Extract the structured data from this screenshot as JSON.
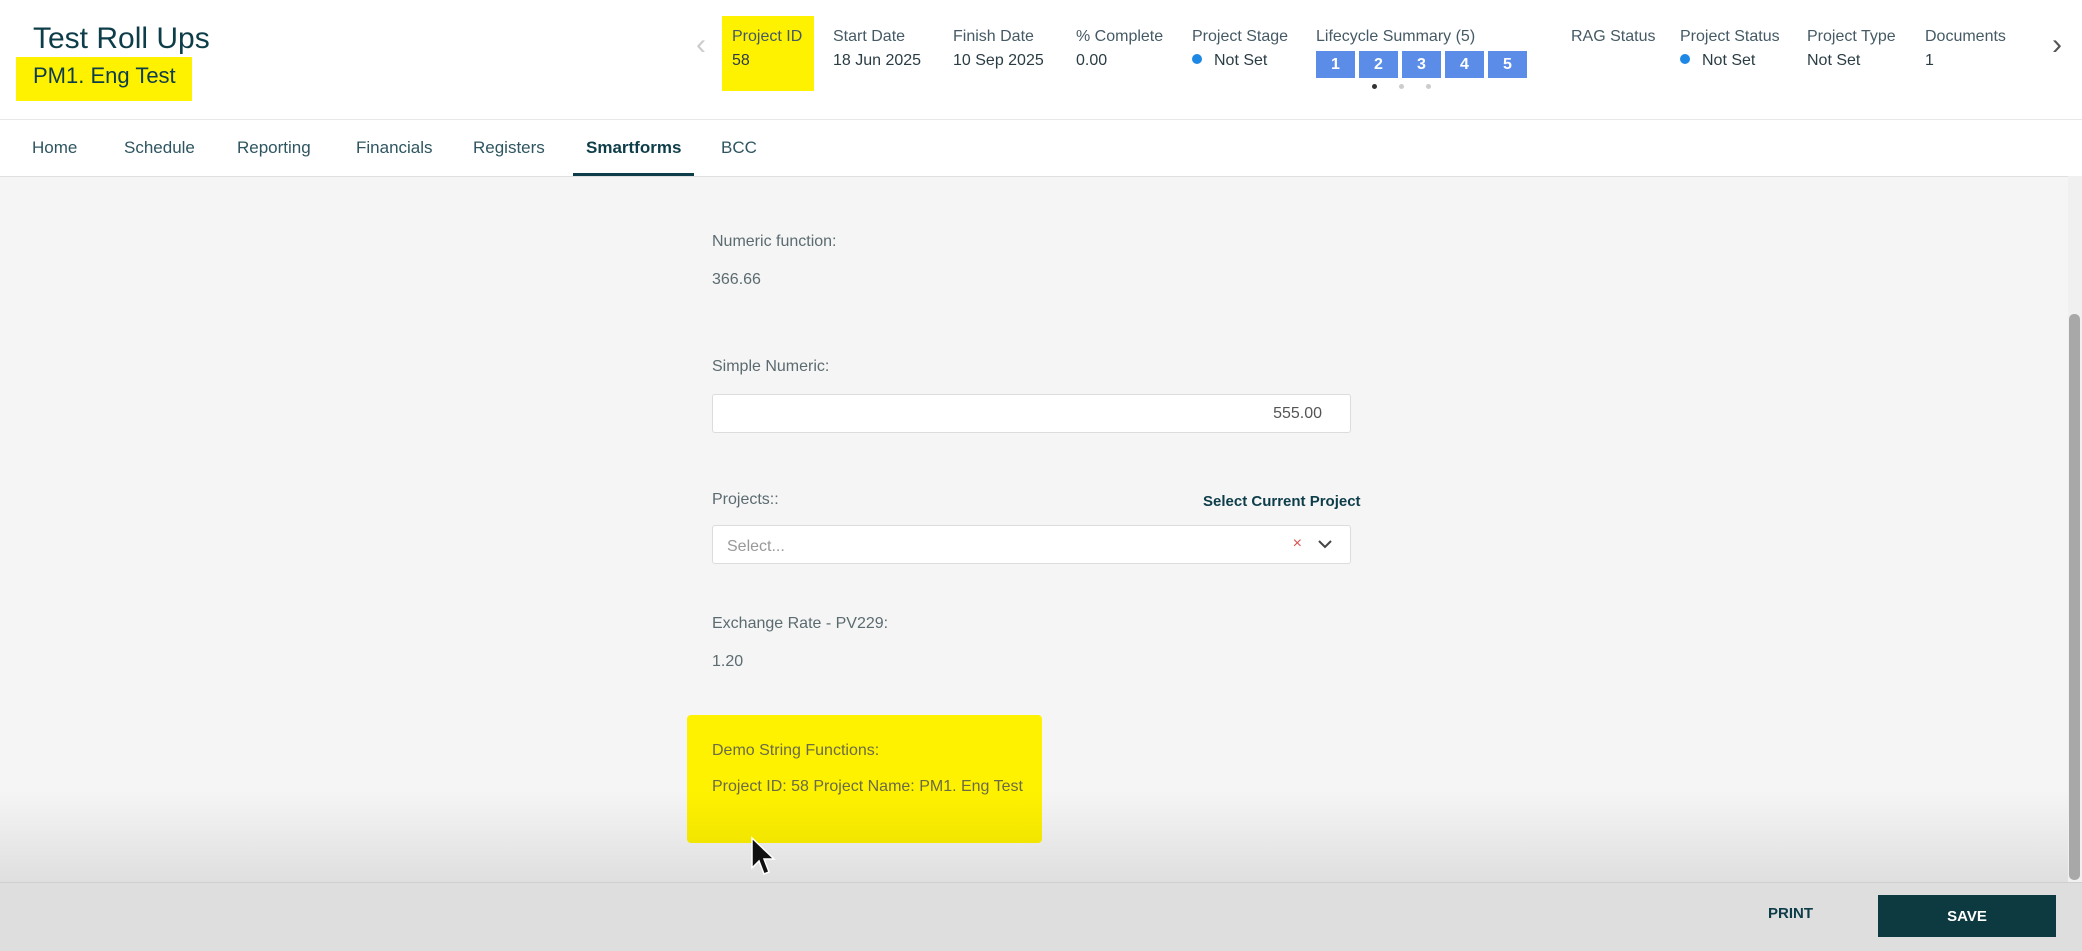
{
  "header": {
    "project_name": "Test Roll Ups",
    "project_sub": "PM1. Eng Test",
    "meta": {
      "project_id": {
        "label": "Project ID",
        "value": "58"
      },
      "start_date": {
        "label": "Start Date",
        "value": "18 Jun 2025"
      },
      "finish_date": {
        "label": "Finish Date",
        "value": "10 Sep 2025"
      },
      "percent_complete": {
        "label": "% Complete",
        "value": "0.00"
      },
      "project_stage": {
        "label": "Project Stage",
        "value": "Not Set"
      },
      "lifecycle_summary": {
        "label": "Lifecycle Summary (5)",
        "boxes": [
          "1",
          "2",
          "3",
          "4",
          "5"
        ]
      },
      "rag_status": {
        "label": "RAG Status",
        "value": ""
      },
      "project_status": {
        "label": "Project Status",
        "value": "Not Set"
      },
      "project_type": {
        "label": "Project Type",
        "value": "Not Set"
      },
      "documents": {
        "label": "Documents",
        "value": "1"
      }
    }
  },
  "tabs": [
    "Home",
    "Schedule",
    "Reporting",
    "Financials",
    "Registers",
    "Smartforms",
    "BCC"
  ],
  "active_tab": "Smartforms",
  "form": {
    "numeric_function": {
      "label": "Numeric function:",
      "value": "366.66"
    },
    "simple_numeric": {
      "label": "Simple Numeric:",
      "value": "555.00"
    },
    "projects": {
      "label": "Projects::",
      "placeholder": "Select...",
      "select_current": "Select Current Project",
      "clear_glyph": "×"
    },
    "exchange_rate": {
      "label": "Exchange Rate - PV229:",
      "value": "1.20"
    },
    "demo_string": {
      "label": "Demo String Functions:",
      "value": "Project ID: 58 Project Name: PM1. Eng Test"
    }
  },
  "footer": {
    "print_label": "PRINT",
    "save_label": "SAVE"
  },
  "colors": {
    "highlight": "#fff200",
    "primary": "#0d3a40",
    "lifecycle_box": "#5b8de8",
    "status_dot": "#1e88e5"
  },
  "icons": {
    "nav_prev": "chevron-left-icon",
    "nav_next": "chevron-right-icon",
    "select_chevron": "chevron-down-icon",
    "clear": "close-icon",
    "cursor": "mouse-pointer-icon"
  }
}
